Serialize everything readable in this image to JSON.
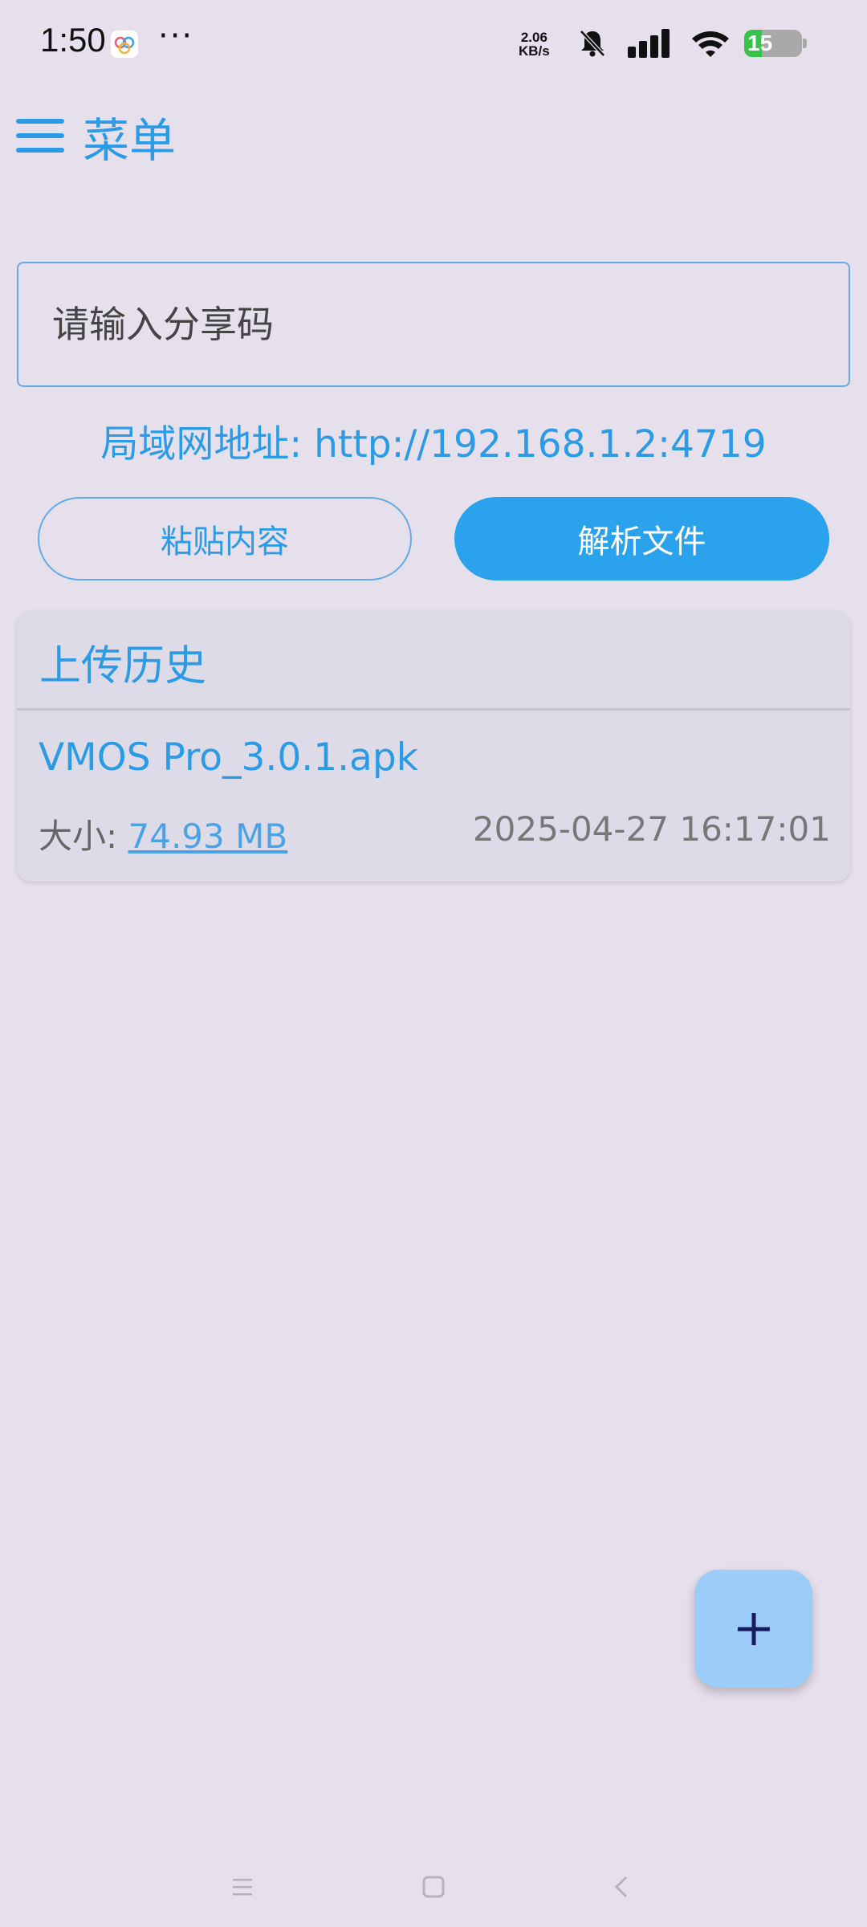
{
  "status_bar": {
    "time": "1:50",
    "more": "···",
    "net_speed_value": "2.06",
    "net_speed_unit": "KB/s",
    "battery": "15"
  },
  "header": {
    "menu_label": "菜单"
  },
  "share_input": {
    "placeholder": "请输入分享码"
  },
  "lan": {
    "text": "局域网地址: http://192.168.1.2:4719"
  },
  "buttons": {
    "paste": "粘贴内容",
    "parse": "解析文件"
  },
  "history": {
    "title": "上传历史",
    "items": [
      {
        "name": "VMOS Pro_3.0.1.apk",
        "size_label": "大小: ",
        "size": "74.93 MB",
        "time": "2025-04-27 16:17:01"
      }
    ]
  },
  "fab": {
    "icon": "plus-icon"
  },
  "colors": {
    "background": "#e6dfec",
    "accent": "#2b9be6",
    "primary_button": "#2aa3ec",
    "fab": "#9ccdf8",
    "battery_green": "#37c24c"
  }
}
